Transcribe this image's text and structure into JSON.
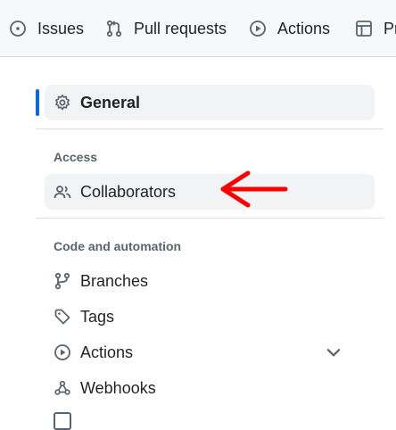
{
  "top_nav": {
    "issues_label": "Issues",
    "pulls_label": "Pull requests",
    "actions_label": "Actions",
    "projects_label": "Pr"
  },
  "sidebar": {
    "general_label": "General",
    "access_heading": "Access",
    "collaborators_label": "Collaborators",
    "code_heading": "Code and automation",
    "items": [
      {
        "label": "Branches",
        "icon": "git-branch-icon"
      },
      {
        "label": "Tags",
        "icon": "tag-icon"
      },
      {
        "label": "Actions",
        "icon": "play-icon"
      },
      {
        "label": "Webhooks",
        "icon": "webhook-icon"
      }
    ]
  },
  "colors": {
    "active_marker": "#0969da",
    "annotation_arrow": "#ff0000",
    "selected_bg": "#f1f3f5"
  }
}
